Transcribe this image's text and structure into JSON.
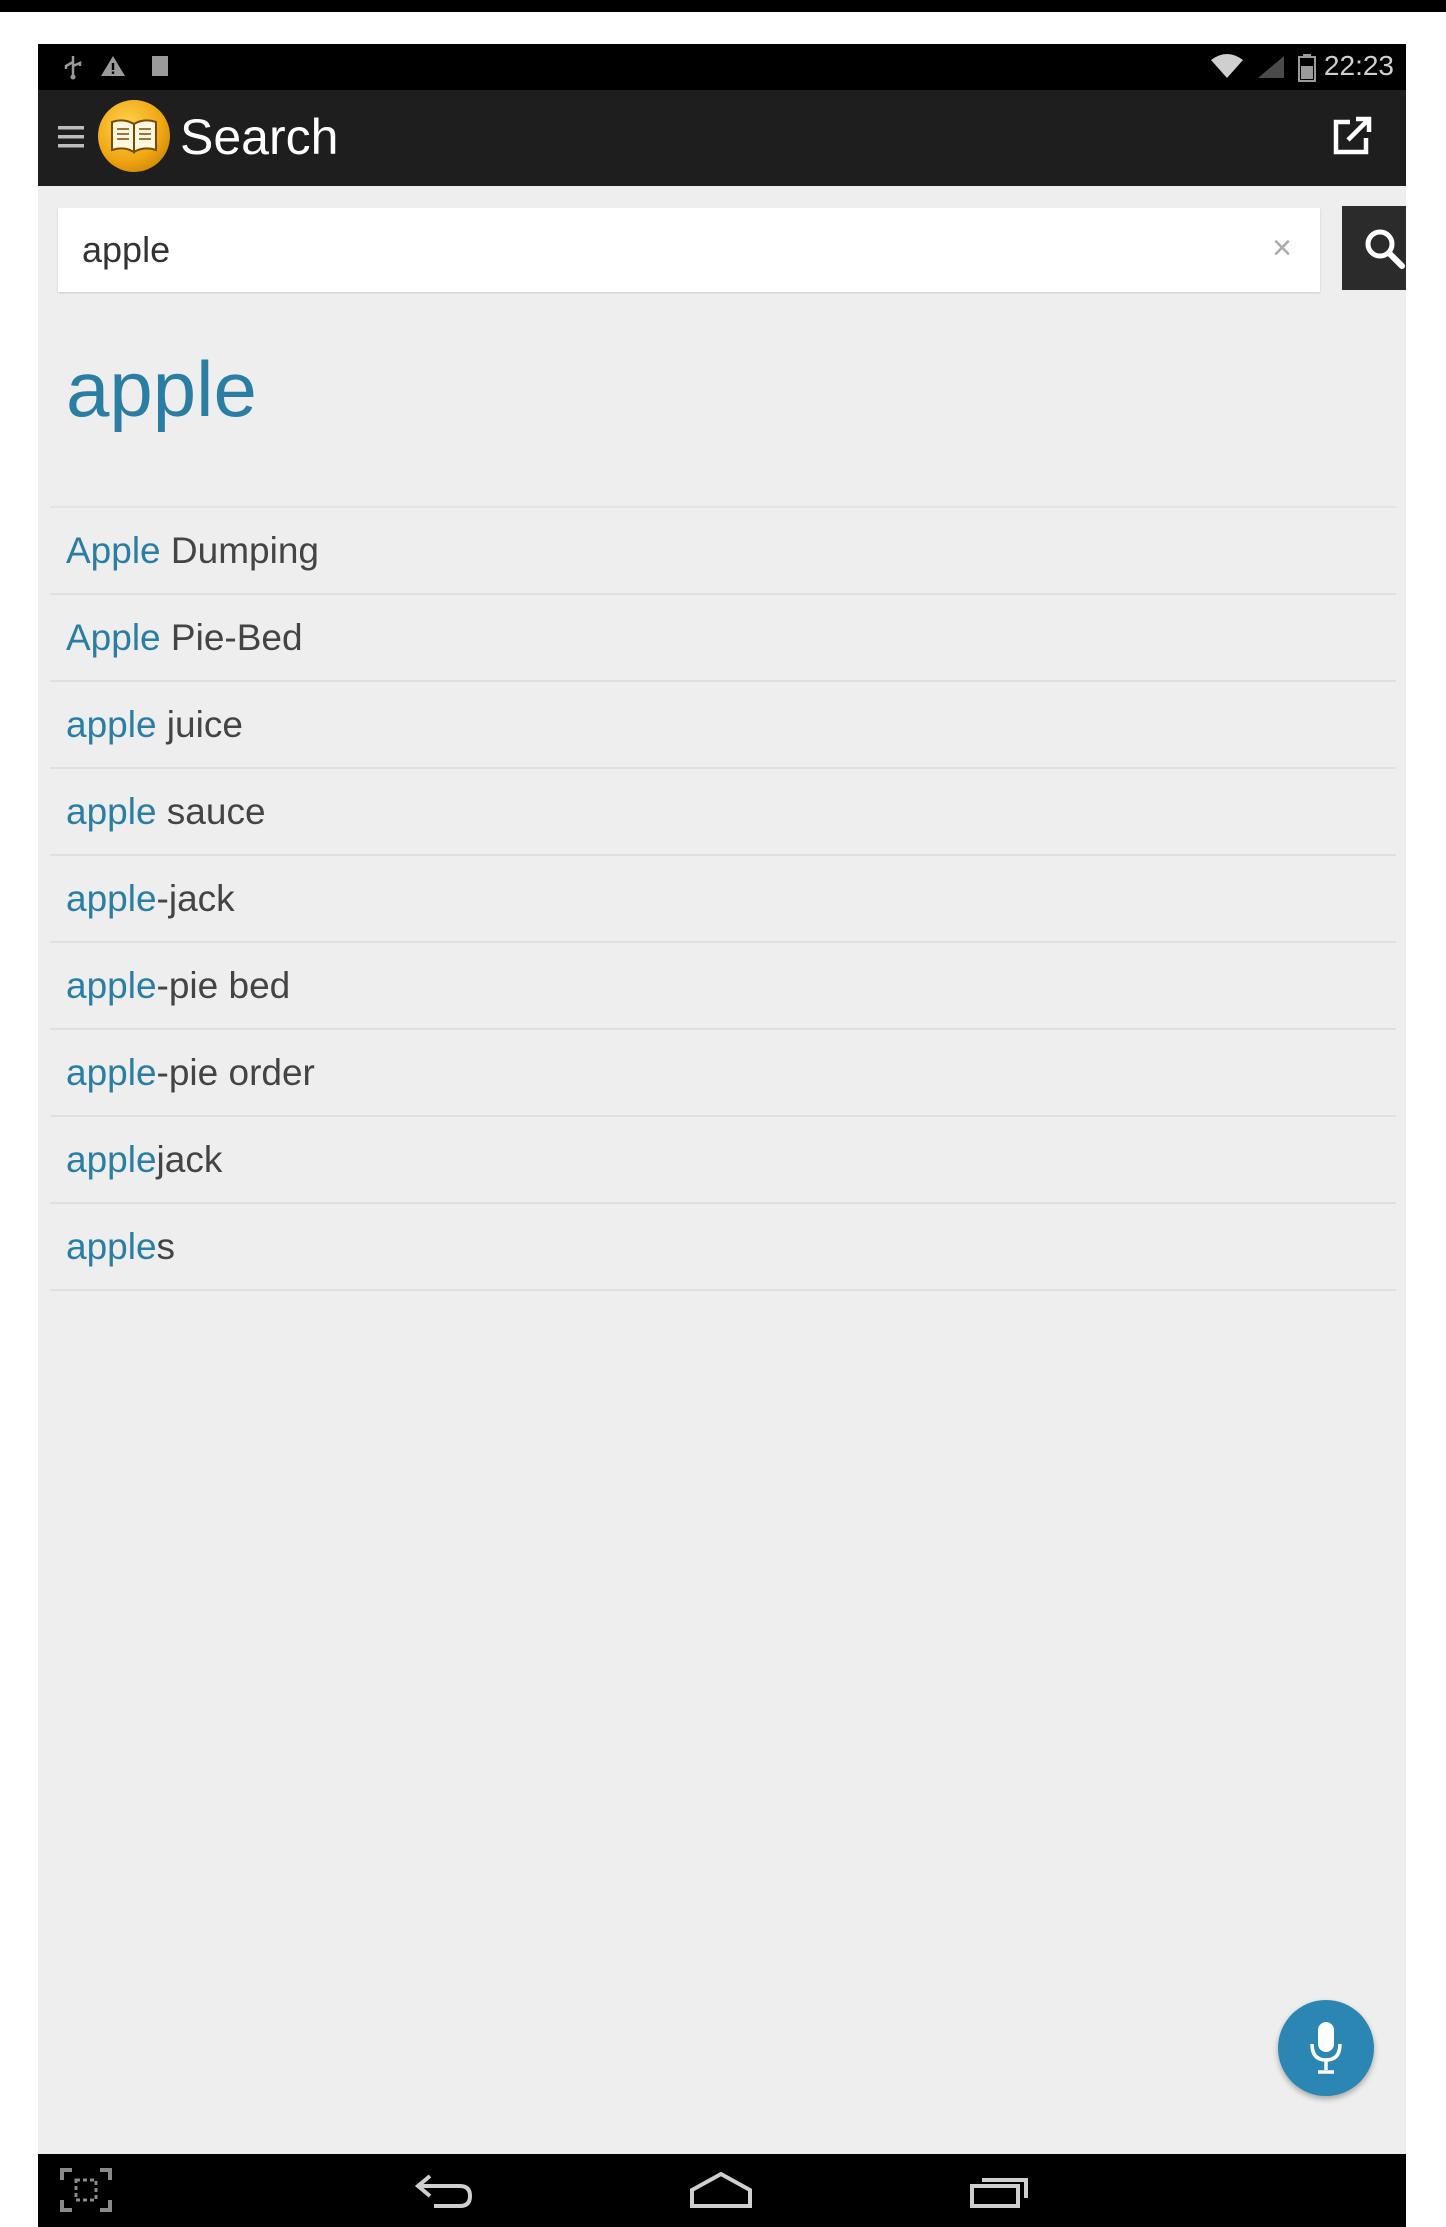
{
  "status_bar": {
    "time": "22:23",
    "icons": [
      "usb-icon",
      "warning-icon",
      "image-icon",
      "wifi-icon",
      "signal-icon",
      "battery-icon"
    ]
  },
  "action_bar": {
    "title": "Search",
    "icons": [
      "menu-icon",
      "dictionary-logo",
      "share-icon"
    ]
  },
  "search": {
    "value": "apple",
    "clear_glyph": "×"
  },
  "result_heading": "apple",
  "results": [
    {
      "match": "Apple",
      "rest": " Dumping"
    },
    {
      "match": "Apple",
      "rest": " Pie-Bed"
    },
    {
      "match": "apple",
      "rest": " juice"
    },
    {
      "match": "apple",
      "rest": " sauce"
    },
    {
      "match": "apple",
      "rest": "-jack"
    },
    {
      "match": "apple",
      "rest": "-pie bed"
    },
    {
      "match": "apple",
      "rest": "-pie order"
    },
    {
      "match": "apple",
      "rest": "jack"
    },
    {
      "match": "apple",
      "rest": "s"
    }
  ],
  "colors": {
    "accent": "#2a7ea3",
    "fab": "#2b86b4",
    "action_bar": "#1e1e1e",
    "background": "#eeeeee"
  }
}
